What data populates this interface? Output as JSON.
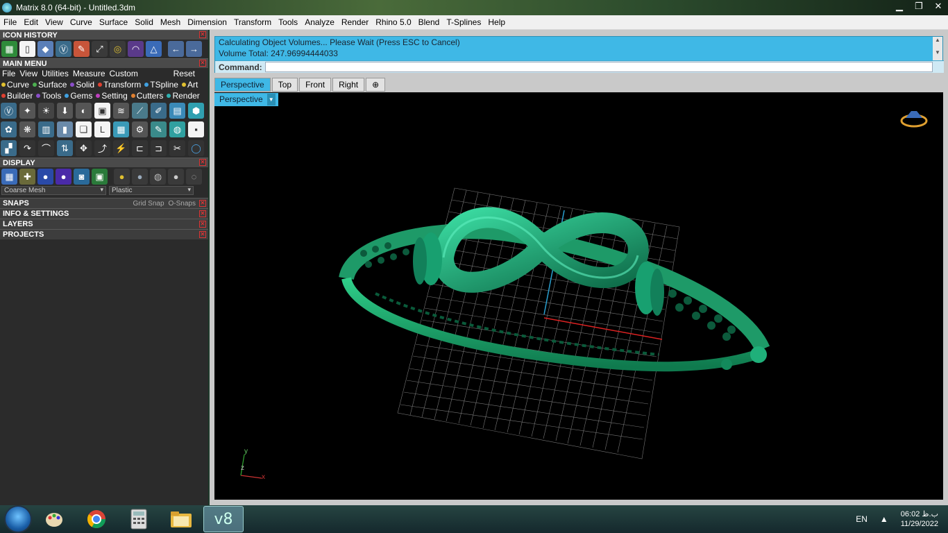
{
  "window": {
    "title": "Matrix 8.0 (64-bit) - Untitled.3dm"
  },
  "menubar": [
    "File",
    "Edit",
    "View",
    "Curve",
    "Surface",
    "Solid",
    "Mesh",
    "Dimension",
    "Transform",
    "Tools",
    "Analyze",
    "Render",
    "Rhino 5.0",
    "Blend",
    "T-Splines",
    "Help"
  ],
  "left": {
    "icon_history": "ICON HISTORY",
    "main_menu": "MAIN MENU",
    "main_menu_items": [
      "File",
      "View",
      "Utilities",
      "Measure",
      "Custom"
    ],
    "reset": "Reset",
    "categories_row1": [
      {
        "label": "Curve",
        "color": "#e0c030"
      },
      {
        "label": "Surface",
        "color": "#4caf50"
      },
      {
        "label": "Solid",
        "color": "#8a4ec8"
      },
      {
        "label": "Transform",
        "color": "#e04030"
      },
      {
        "label": "TSpline",
        "color": "#40a0e0"
      },
      {
        "label": "Art",
        "color": "#e0c030"
      }
    ],
    "categories_row2": [
      {
        "label": "Builder",
        "color": "#e04030"
      },
      {
        "label": "Tools",
        "color": "#8a4ec8"
      },
      {
        "label": "Gems",
        "color": "#40a0e0"
      },
      {
        "label": "Setting",
        "color": "#c040c0"
      },
      {
        "label": "Cutters",
        "color": "#e08030"
      },
      {
        "label": "Render",
        "color": "#30b0b0"
      }
    ],
    "display": "DISPLAY",
    "mesh_select": "Coarse Mesh",
    "material_select": "Plastic",
    "snaps": "SNAPS",
    "grid_snap": "Grid Snap",
    "osnaps": "O-Snaps",
    "info_settings": "INFO & SETTINGS",
    "layers": "LAYERS",
    "projects": "PROJECTS"
  },
  "command": {
    "line1": "Calculating Object Volumes... Please Wait (Press ESC to Cancel)",
    "line2": "Volume Total: 247.96994444033",
    "prompt": "Command:",
    "value": ""
  },
  "tabs": [
    "Perspective",
    "Top",
    "Front",
    "Right",
    "⊕"
  ],
  "viewport": {
    "label": "Perspective",
    "axis_x": "x",
    "axis_y": "y",
    "axis_z": "z"
  },
  "taskbar": {
    "lang": "EN",
    "time": "06:02 ب.ظ",
    "date": "11/29/2022",
    "active_app": "v8"
  }
}
